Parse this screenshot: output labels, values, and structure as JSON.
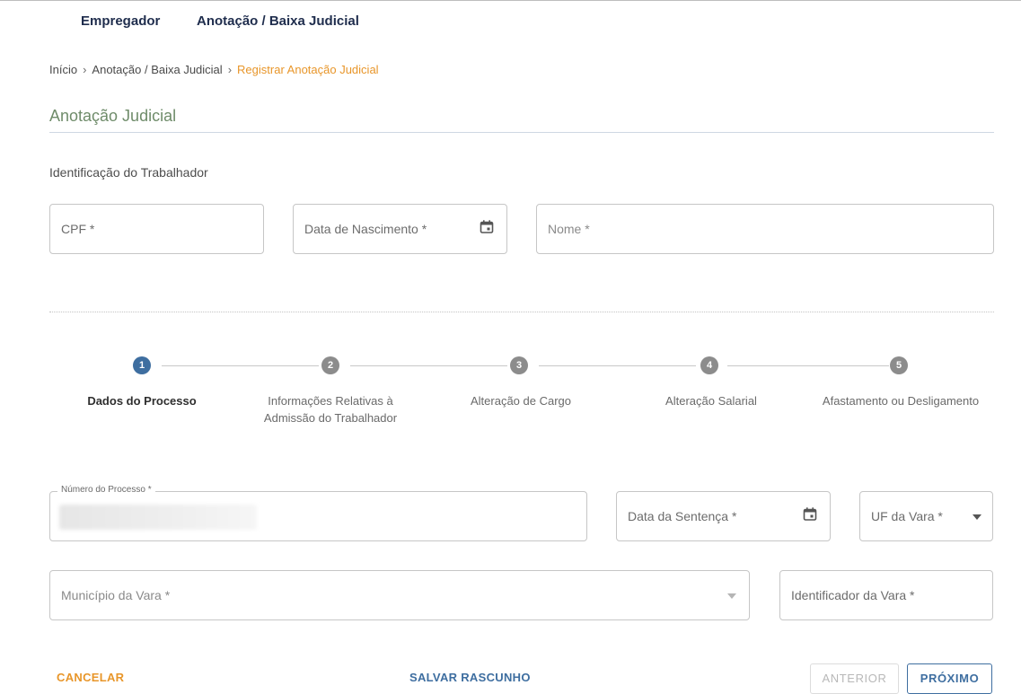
{
  "nav": {
    "items": [
      {
        "label": "Empregador"
      },
      {
        "label": "Anotação / Baixa Judicial"
      }
    ]
  },
  "breadcrumb": {
    "items": [
      "Início",
      "Anotação / Baixa Judicial"
    ],
    "current": "Registrar Anotação Judicial",
    "separator": "›"
  },
  "page": {
    "title": "Anotação Judicial",
    "section": "Identificação do Trabalhador"
  },
  "worker": {
    "cpf_placeholder": "CPF *",
    "birth_placeholder": "Data de Nascimento *",
    "name_placeholder": "Nome *"
  },
  "steps": [
    {
      "number": "1",
      "label": "Dados do Processo",
      "active": true
    },
    {
      "number": "2",
      "label": "Informações Relativas à Admissão do Trabalhador",
      "active": false
    },
    {
      "number": "3",
      "label": "Alteração de Cargo",
      "active": false
    },
    {
      "number": "4",
      "label": "Alteração Salarial",
      "active": false
    },
    {
      "number": "5",
      "label": "Afastamento ou Desligamento",
      "active": false
    }
  ],
  "process": {
    "number_label": "Número do Processo *",
    "sentence_date_placeholder": "Data da Sentença *",
    "uf_placeholder": "UF da Vara *",
    "municipio_placeholder": "Município da Vara *",
    "identificador_placeholder": "Identificador da Vara *"
  },
  "actions": {
    "cancel": "CANCELAR",
    "save_draft": "SALVAR RASCUNHO",
    "previous": "ANTERIOR",
    "next": "PRÓXIMO"
  },
  "colors": {
    "accent_orange": "#e8962a",
    "primary_blue": "#3e6ea0",
    "step_active": "#3e6ea0",
    "step_inactive": "#8c8c8c"
  },
  "icons": {
    "calendar": "calendar-icon",
    "dropdown": "caret-down-icon"
  }
}
